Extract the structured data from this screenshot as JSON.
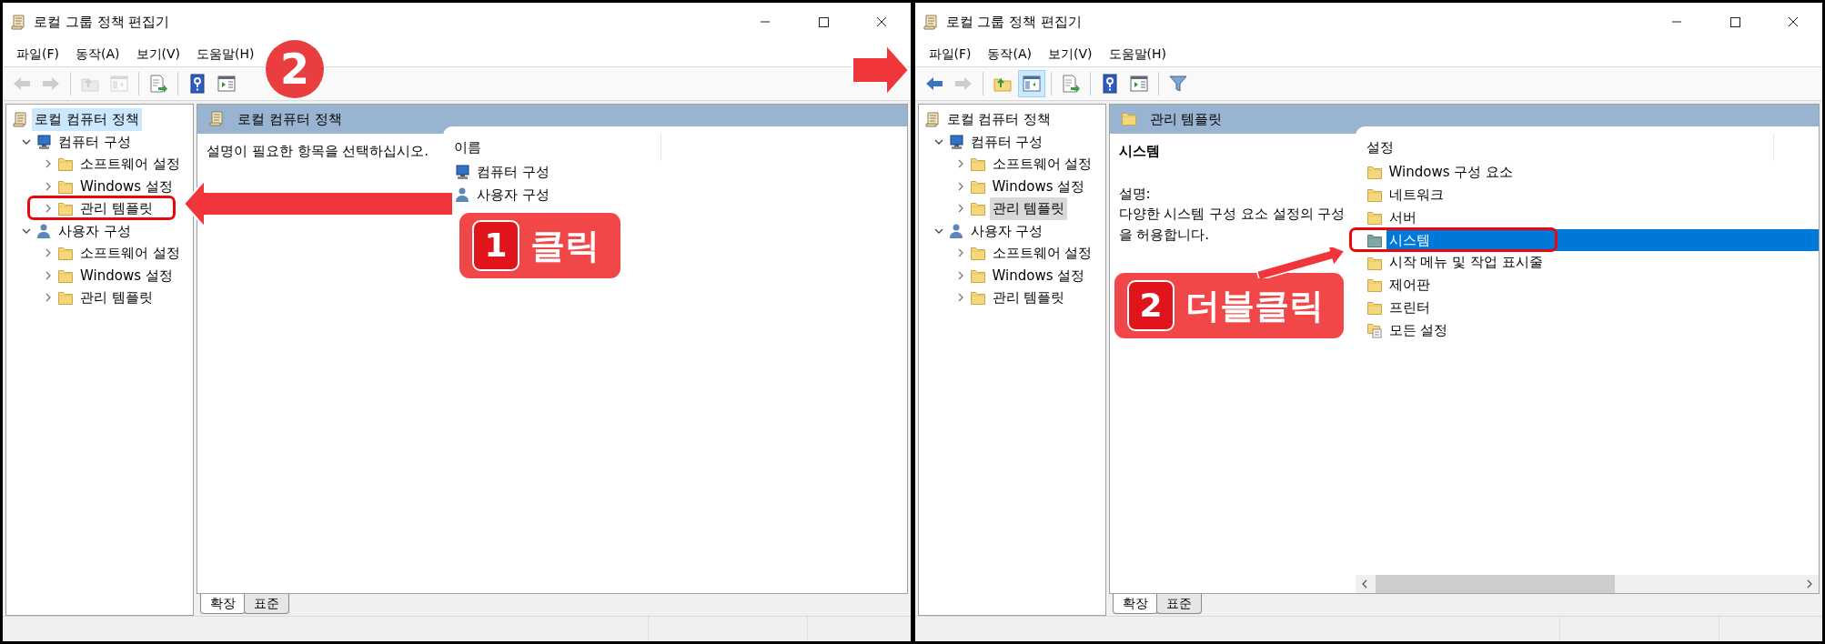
{
  "windows": [
    {
      "title": "로컬 그룹 정책 편집기",
      "menu": [
        "파일(F)",
        "동작(A)",
        "보기(V)",
        "도움말(H)"
      ],
      "toolbar": [
        [
          {
            "kind": "back",
            "disabled": true,
            "pressed": false
          },
          {
            "kind": "forward",
            "disabled": true,
            "pressed": false
          }
        ],
        [
          {
            "kind": "up-folder",
            "disabled": true,
            "pressed": false
          },
          {
            "kind": "show-tree",
            "disabled": true,
            "pressed": false
          }
        ],
        [
          {
            "kind": "export",
            "disabled": false,
            "pressed": false
          }
        ],
        [
          {
            "kind": "help",
            "disabled": false,
            "pressed": false
          },
          {
            "kind": "view",
            "disabled": false,
            "pressed": false
          }
        ]
      ],
      "tree_focused": true,
      "tree": [
        {
          "label": "로컬 컴퓨터 정책",
          "kind": "policy",
          "selected": true,
          "children": [
            {
              "label": "컴퓨터 구성",
              "kind": "computer",
              "expanded": true,
              "selected": false,
              "children": [
                {
                  "label": "소프트웨어 설정",
                  "kind": "folder",
                  "expanded": false,
                  "selected": false
                },
                {
                  "label": "Windows 설정",
                  "kind": "folder",
                  "expanded": false,
                  "selected": false
                },
                {
                  "label": "관리 템플릿",
                  "kind": "folder",
                  "expanded": false,
                  "selected": false
                }
              ]
            },
            {
              "label": "사용자 구성",
              "kind": "user",
              "expanded": true,
              "selected": false,
              "children": [
                {
                  "label": "소프트웨어 설정",
                  "kind": "folder",
                  "expanded": false,
                  "selected": false
                },
                {
                  "label": "Windows 설정",
                  "kind": "folder",
                  "expanded": false,
                  "selected": false
                },
                {
                  "label": "관리 템플릿",
                  "kind": "folder",
                  "expanded": false,
                  "selected": false
                }
              ]
            }
          ]
        }
      ],
      "details": {
        "header": {
          "label": "로컬 컴퓨터 정책",
          "kind": "policy"
        },
        "description": "설명이 필요한 항목을 선택하십시오.",
        "column": "이름",
        "items": [
          {
            "label": "컴퓨터 구성",
            "kind": "computer",
            "selected": false
          },
          {
            "label": "사용자 구성",
            "kind": "user",
            "selected": false
          }
        ]
      },
      "view_tabs": [
        {
          "label": "확장",
          "selected": true
        },
        {
          "label": "표준",
          "selected": false
        }
      ]
    },
    {
      "title": "로컬 그룹 정책 편집기",
      "menu": [
        "파일(F)",
        "동작(A)",
        "보기(V)",
        "도움말(H)"
      ],
      "toolbar": [
        [
          {
            "kind": "back",
            "disabled": false,
            "pressed": false
          },
          {
            "kind": "forward",
            "disabled": true,
            "pressed": false
          }
        ],
        [
          {
            "kind": "up-folder",
            "disabled": false,
            "pressed": false
          },
          {
            "kind": "show-tree",
            "disabled": false,
            "pressed": true
          }
        ],
        [
          {
            "kind": "export",
            "disabled": false,
            "pressed": false
          }
        ],
        [
          {
            "kind": "help",
            "disabled": false,
            "pressed": false
          },
          {
            "kind": "view",
            "disabled": false,
            "pressed": false
          }
        ],
        [
          {
            "kind": "filter",
            "disabled": false,
            "pressed": false
          }
        ]
      ],
      "tree_focused": false,
      "tree": [
        {
          "label": "로컬 컴퓨터 정책",
          "kind": "policy",
          "selected": false,
          "children": [
            {
              "label": "컴퓨터 구성",
              "kind": "computer",
              "expanded": true,
              "selected": false,
              "children": [
                {
                  "label": "소프트웨어 설정",
                  "kind": "folder",
                  "expanded": false,
                  "selected": false
                },
                {
                  "label": "Windows 설정",
                  "kind": "folder",
                  "expanded": false,
                  "selected": false
                },
                {
                  "label": "관리 템플릿",
                  "kind": "folder",
                  "expanded": false,
                  "selected": true
                }
              ]
            },
            {
              "label": "사용자 구성",
              "kind": "user",
              "expanded": true,
              "selected": false,
              "children": [
                {
                  "label": "소프트웨어 설정",
                  "kind": "folder",
                  "expanded": false,
                  "selected": false
                },
                {
                  "label": "Windows 설정",
                  "kind": "folder",
                  "expanded": false,
                  "selected": false
                },
                {
                  "label": "관리 템플릿",
                  "kind": "folder",
                  "expanded": false,
                  "selected": false
                }
              ]
            }
          ]
        }
      ],
      "details": {
        "header": {
          "label": "관리 템플릿",
          "kind": "folder"
        },
        "title": "시스템",
        "description_label": "설명:",
        "description": "다양한 시스템 구성 요소 설정의 구성을 허용합니다.",
        "column": "설정",
        "items": [
          {
            "label": "Windows 구성 요소",
            "kind": "folder",
            "selected": false
          },
          {
            "label": "네트워크",
            "kind": "folder",
            "selected": false
          },
          {
            "label": "서버",
            "kind": "folder",
            "selected": false
          },
          {
            "label": "시스템",
            "kind": "special-folder",
            "selected": true
          },
          {
            "label": "시작 메뉴 및 작업 표시줄",
            "kind": "folder",
            "selected": false
          },
          {
            "label": "제어판",
            "kind": "folder",
            "selected": false
          },
          {
            "label": "프린터",
            "kind": "folder",
            "selected": false
          },
          {
            "label": "모든 설정",
            "kind": "all-settings",
            "selected": false
          }
        ]
      },
      "scrollbar": true,
      "view_tabs": [
        {
          "label": "확장",
          "selected": true
        },
        {
          "label": "표준",
          "selected": false
        }
      ]
    }
  ],
  "annotations": [
    {
      "kind": "step-circle",
      "text": "2"
    },
    {
      "kind": "highlight"
    },
    {
      "kind": "arrow-left"
    },
    {
      "kind": "callout",
      "number": "1",
      "text": "클릭"
    },
    {
      "kind": "arrow-right"
    },
    {
      "kind": "highlight"
    },
    {
      "kind": "callout",
      "number": "2",
      "text": "더블클릭"
    },
    {
      "kind": "arrow-diagonal"
    }
  ]
}
